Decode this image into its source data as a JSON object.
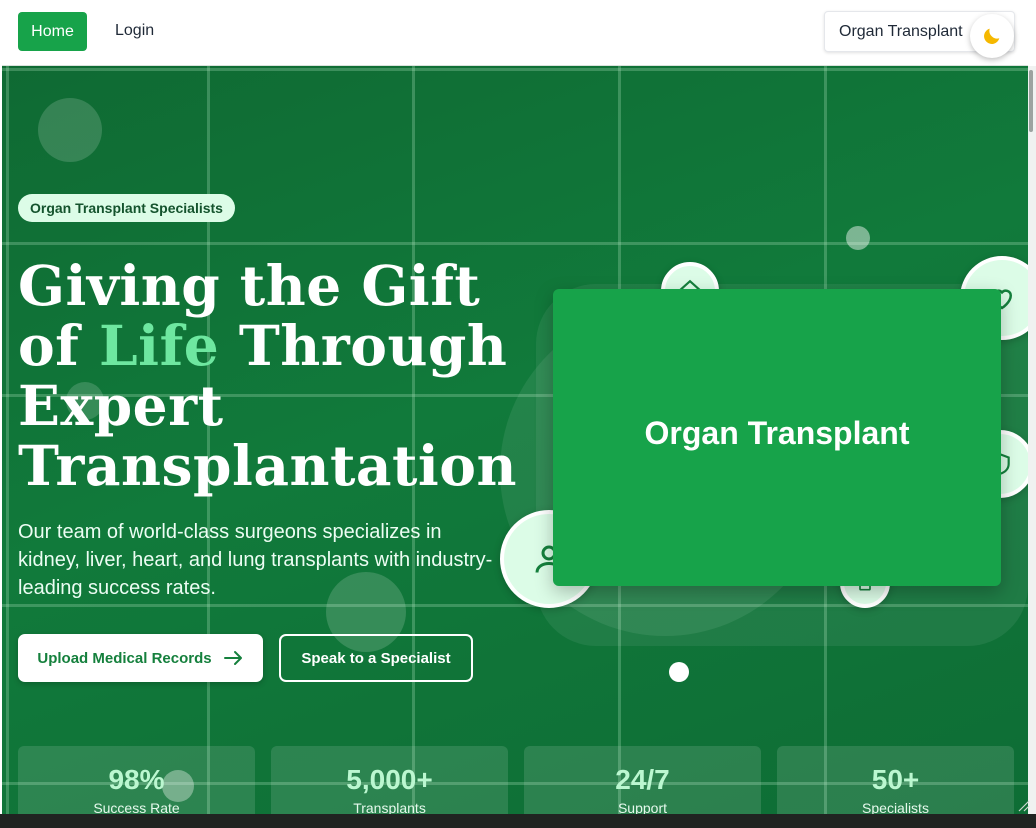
{
  "nav": {
    "home_label": "Home",
    "login_label": "Login",
    "brand_label": "Organ Transplant",
    "theme_icon": "moon-icon"
  },
  "hero": {
    "badge": "Organ Transplant Specialists",
    "headline_part1": "Giving the Gift of ",
    "headline_accent": "Life",
    "headline_part2": " Through Expert Transplantation",
    "lead": "Our team of world-class surgeons specializes in kidney, liver, heart, and lung transplants with industry-leading success rates.",
    "primary_cta": "Upload Medical Records",
    "secondary_cta": "Speak to a Specialist",
    "card_title": "Organ Transplant",
    "floating_icons": [
      "home-icon",
      "heart-icon",
      "shield-icon",
      "user-icon",
      "clipboard-icon"
    ]
  },
  "stats": [
    {
      "value": "98%",
      "label": "Success Rate"
    },
    {
      "value": "5,000+",
      "label": "Transplants"
    },
    {
      "value": "24/7",
      "label": "Support"
    },
    {
      "value": "50+",
      "label": "Specialists"
    }
  ],
  "colors": {
    "primary": "#17a34a",
    "hero_bg": "#117a3b",
    "accent_text": "#6ee7a0",
    "badge_bg": "#dcfce7"
  }
}
